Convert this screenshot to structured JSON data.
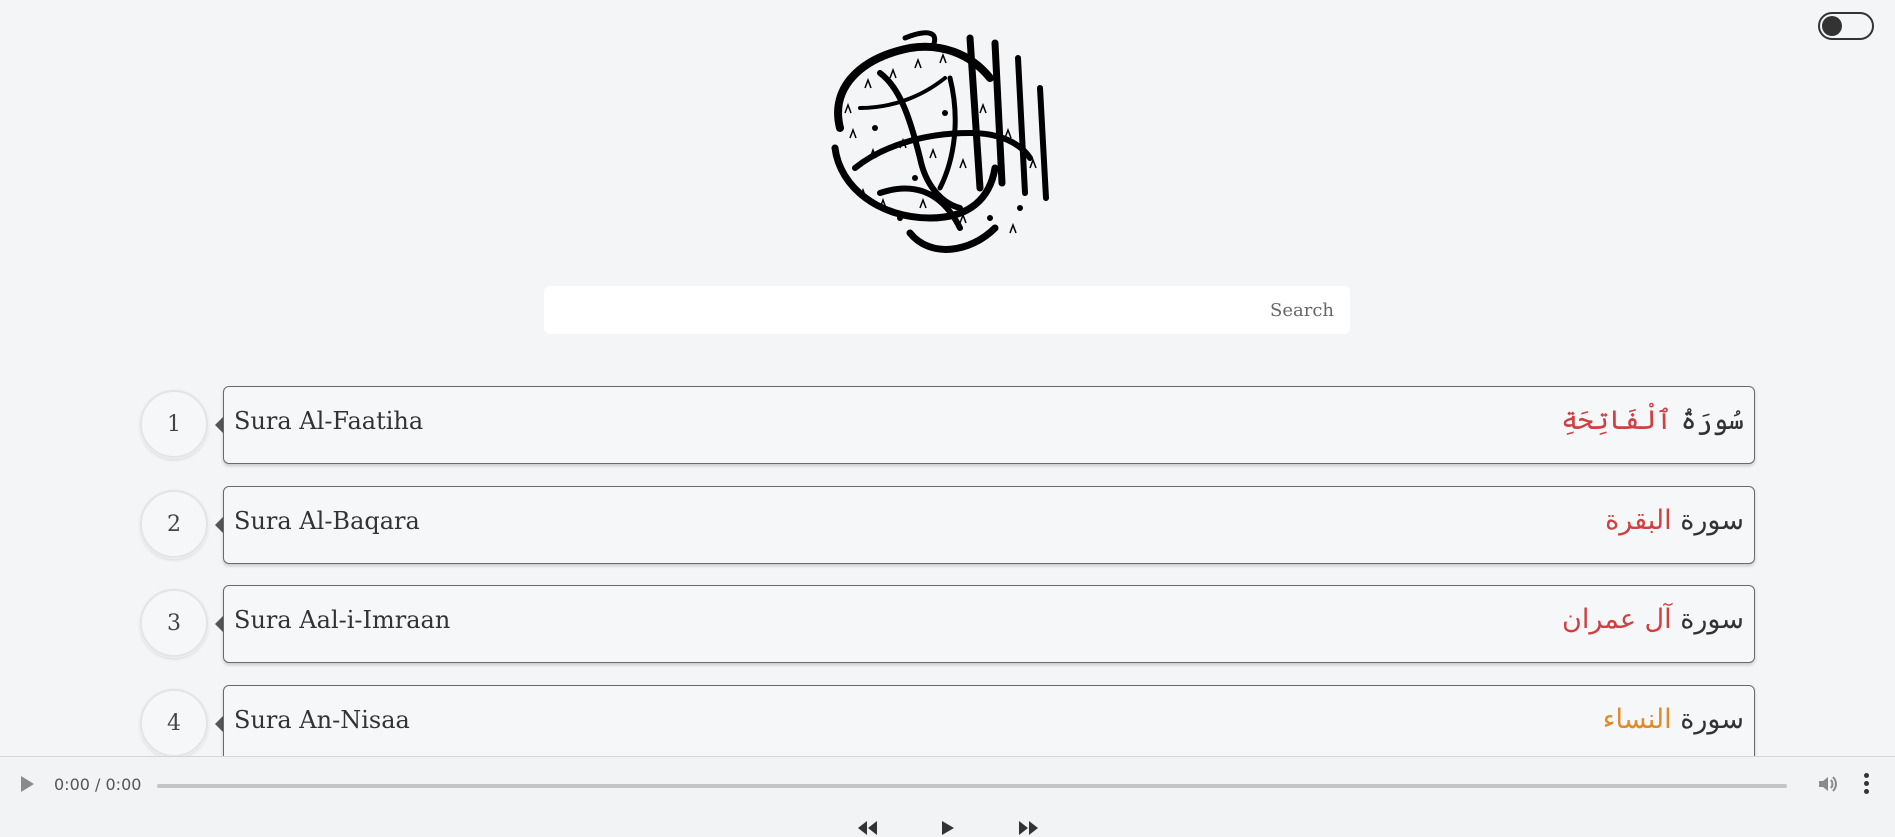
{
  "theme_toggle": {
    "state": "off"
  },
  "logo": {
    "alt": "Al-Quran Al-Kareem calligraphy"
  },
  "search": {
    "placeholder": "Search",
    "value": ""
  },
  "suras": [
    {
      "number": "1",
      "english": "Sura Al-Faatiha",
      "arabic_base": "سُورَةُ ",
      "arabic_hl": "ٱلْفَاتِحَةِ"
    },
    {
      "number": "2",
      "english": "Sura Al-Baqara",
      "arabic_base": "سورة ",
      "arabic_hl": "البقرة"
    },
    {
      "number": "3",
      "english": "Sura Aal-i-Imraan",
      "arabic_base": "سورة ",
      "arabic_hl": "آل عمران"
    },
    {
      "number": "4",
      "english": "Sura An-Nisaa",
      "arabic_base": "سورة ",
      "arabic_hl": "النساء"
    }
  ],
  "player": {
    "time": "0:00 / 0:00",
    "controls": [
      "rewind-icon",
      "play-icon",
      "fast-forward-icon"
    ]
  },
  "colors": {
    "background": "#f4f5f7",
    "highlight": "#d04040",
    "orange": "#e08a2a"
  }
}
